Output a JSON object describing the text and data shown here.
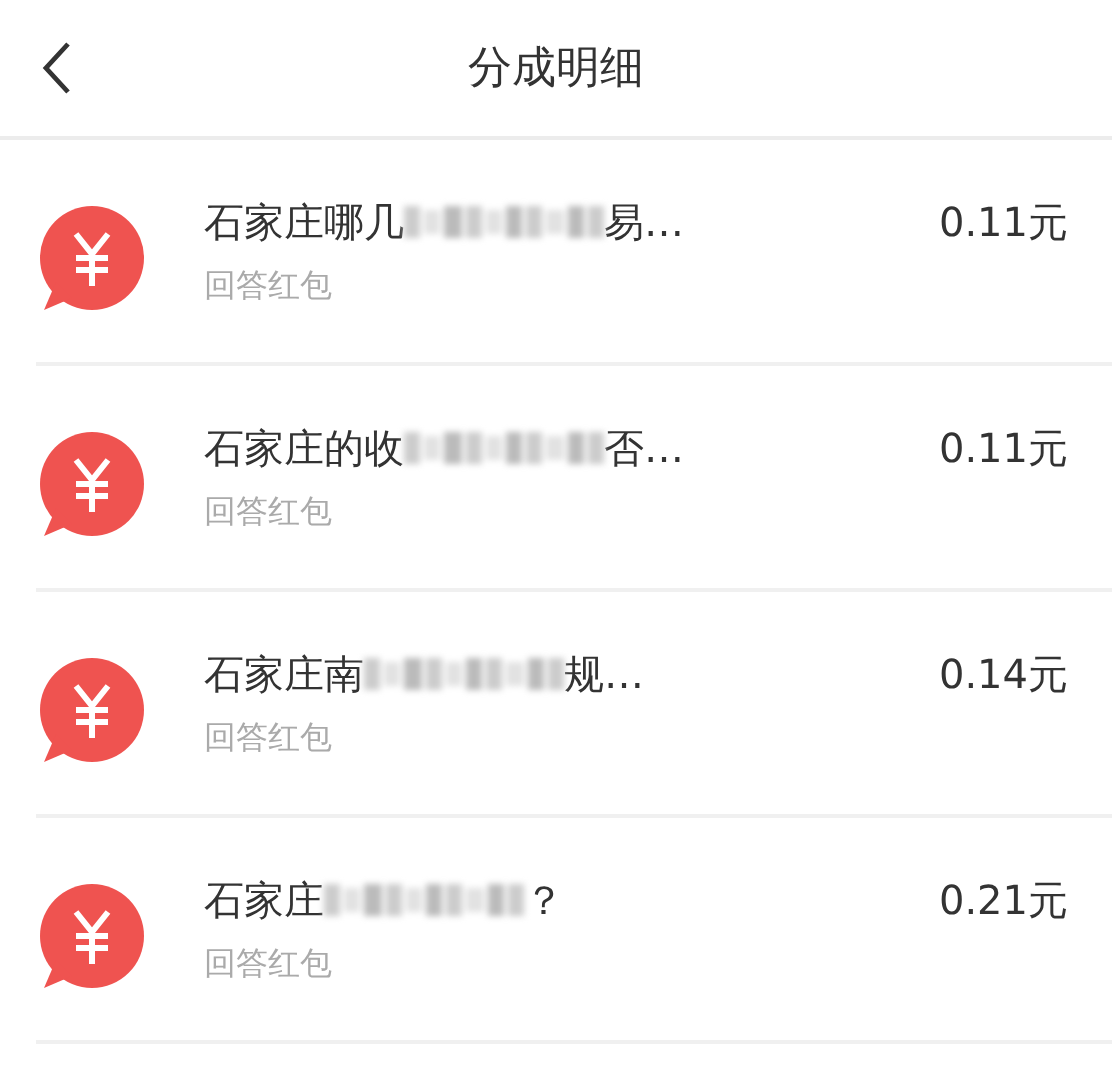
{
  "header": {
    "title": "分成明细"
  },
  "items": [
    {
      "title_start": "石家庄哪几",
      "title_end": "易…",
      "subtitle": "回答红包",
      "amount": "0.11元"
    },
    {
      "title_start": "石家庄的收",
      "title_end": "否…",
      "subtitle": "回答红包",
      "amount": "0.11元"
    },
    {
      "title_start": "石家庄南",
      "title_end": "规…",
      "subtitle": "回答红包",
      "amount": "0.14元"
    },
    {
      "title_start": "石家庄",
      "title_end": "？",
      "subtitle": "回答红包",
      "amount": "0.21元"
    }
  ]
}
